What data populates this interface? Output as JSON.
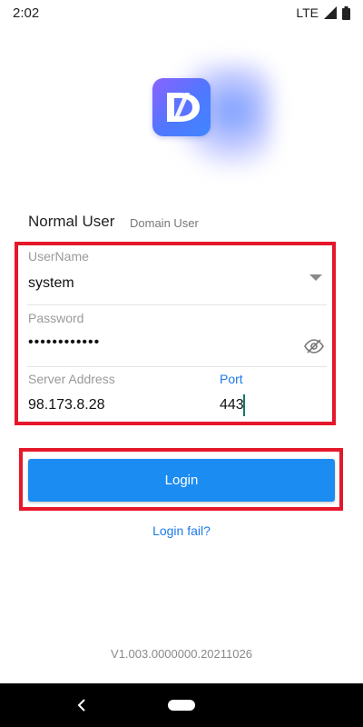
{
  "status_bar": {
    "time": "2:02",
    "network": "LTE",
    "icons": [
      "signal-icon",
      "battery-icon"
    ]
  },
  "logo": {
    "icon": "app-logo-icon",
    "letter": "D"
  },
  "tabs": {
    "normal_user": "Normal User",
    "domain_user": "Domain User",
    "selected": "Normal User"
  },
  "form": {
    "username": {
      "label": "UserName",
      "value": "system"
    },
    "password": {
      "label": "Password",
      "value": "••••••••••••"
    },
    "server_address": {
      "label": "Server Address",
      "value": "98.173.8.28"
    },
    "port": {
      "label": "Port",
      "value": "443"
    }
  },
  "login_button": "Login",
  "login_fail_link": "Login fail?",
  "version": "V1.003.0000000.20211026",
  "colors": {
    "accent": "#1b8cf2",
    "highlight": "#e5172a",
    "link": "#1e7ae6"
  }
}
